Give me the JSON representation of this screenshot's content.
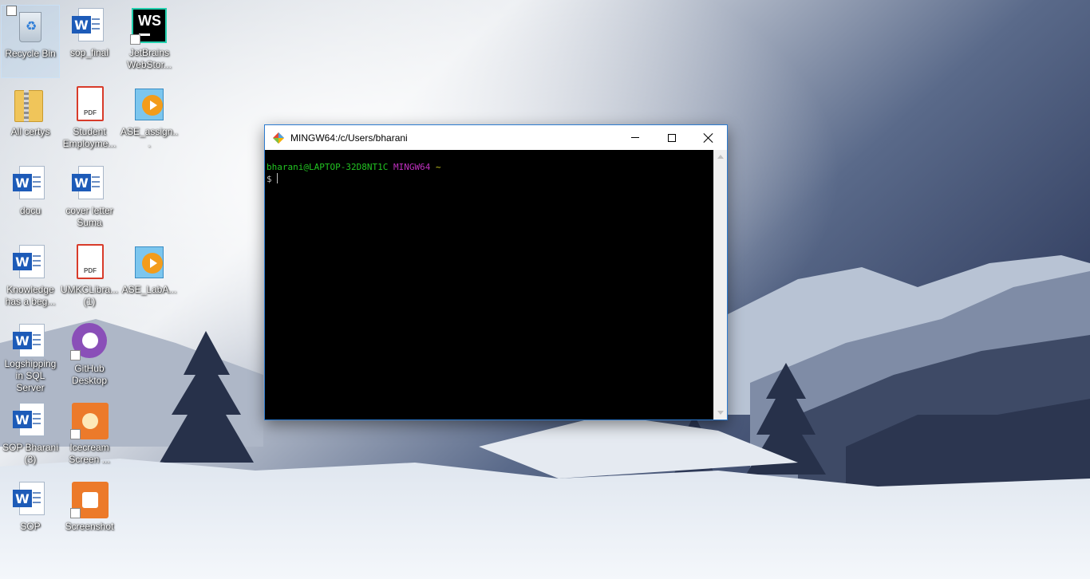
{
  "desktop": {
    "icons": [
      {
        "label": "Recycle Bin",
        "icon": "recycle-bin-icon"
      },
      {
        "label": "sop_final",
        "icon": "word-document-icon"
      },
      {
        "label": "JetBrains WebStor...",
        "icon": "webstorm-icon"
      },
      {
        "label": "All certys",
        "icon": "zip-folder-icon"
      },
      {
        "label": "Student Employme...",
        "icon": "pdf-icon"
      },
      {
        "label": "ASE_assign...",
        "icon": "video-file-icon"
      },
      {
        "label": "docu",
        "icon": "word-document-icon"
      },
      {
        "label": "cover letter Suma",
        "icon": "word-document-icon"
      },
      {
        "label": "Knowledge has a beg...",
        "icon": "word-document-icon"
      },
      {
        "label": "UMKCLibra... (1)",
        "icon": "pdf-icon"
      },
      {
        "label": "ASE_LabA...",
        "icon": "video-file-icon"
      },
      {
        "label": "Logshipping in SQL Server",
        "icon": "word-document-icon"
      },
      {
        "label": "GitHub Desktop",
        "icon": "github-desktop-icon"
      },
      {
        "label": "SOP Bharani (3)",
        "icon": "word-document-icon"
      },
      {
        "label": "Icecream Screen ...",
        "icon": "icecream-screen-recorder-icon"
      },
      {
        "label": "SOP",
        "icon": "word-document-icon"
      },
      {
        "label": "Screenshot",
        "icon": "screenshot-icon"
      }
    ]
  },
  "terminal": {
    "title": "MINGW64:/c/Users/bharani",
    "prompt_user": "bharani@LAPTOP-32D8NT1C",
    "prompt_shell": "MINGW64",
    "prompt_dir": "~",
    "prompt_symbol": "$",
    "controls": [
      "minimize",
      "maximize",
      "close"
    ]
  },
  "word_badge": "W",
  "pdf_badge": "PDF",
  "ws_badge": "WS",
  "colors": {
    "prompt_user": "#22c322",
    "prompt_shell": "#c030c0",
    "prompt_dir": "#c8c820",
    "window_border": "#2c7bd0"
  }
}
